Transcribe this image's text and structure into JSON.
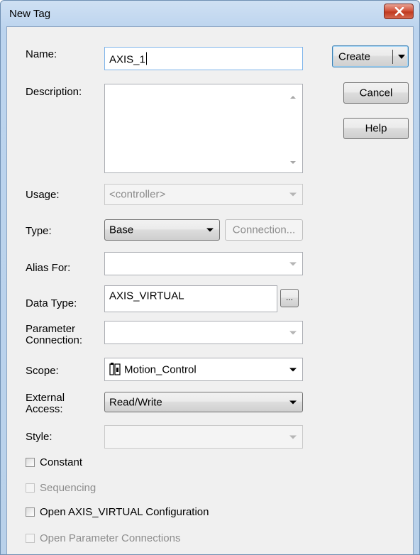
{
  "window": {
    "title": "New Tag"
  },
  "fields": {
    "name": {
      "label": "Name:",
      "value": "AXIS_1"
    },
    "description": {
      "label": "Description:",
      "value": ""
    },
    "usage": {
      "label": "Usage:",
      "value": "<controller>"
    },
    "type": {
      "label": "Type:",
      "value": "Base",
      "connection_button": "Connection..."
    },
    "alias_for": {
      "label": "Alias For:",
      "value": ""
    },
    "data_type": {
      "label": "Data Type:",
      "value": "AXIS_VIRTUAL",
      "browse_button": "..."
    },
    "parameter_connection": {
      "label_line1": "Parameter",
      "label_line2": "Connection:",
      "value": ""
    },
    "scope": {
      "label": "Scope:",
      "value": "Motion_Control",
      "icon": "program-icon"
    },
    "external_access": {
      "label_line1": "External",
      "label_line2": "Access:",
      "value": "Read/Write"
    },
    "style": {
      "label": "Style:",
      "value": ""
    }
  },
  "checkboxes": {
    "constant": {
      "label": "Constant",
      "checked": false,
      "enabled": true
    },
    "sequencing": {
      "label": "Sequencing",
      "checked": false,
      "enabled": false
    },
    "open_configuration": {
      "label": "Open AXIS_VIRTUAL Configuration",
      "checked": false,
      "enabled": true
    },
    "open_parameter_connections": {
      "label": "Open Parameter Connections",
      "checked": false,
      "enabled": false
    }
  },
  "buttons": {
    "create": "Create",
    "cancel": "Cancel",
    "help": "Help"
  }
}
